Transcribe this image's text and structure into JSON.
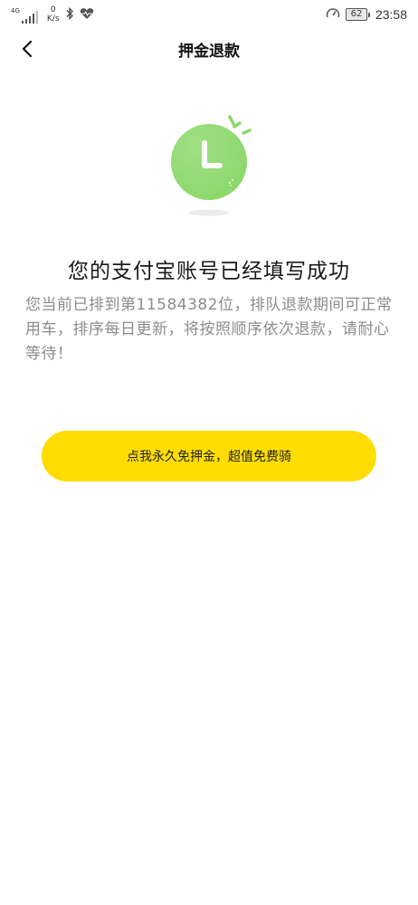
{
  "status_bar": {
    "network": "4G",
    "speed_value": "0",
    "speed_unit": "K/s",
    "battery": "62",
    "time": "23:58"
  },
  "nav": {
    "title": "押金退款"
  },
  "illustration": {
    "clock_letter": "L",
    "accent_color": "#8bd86a"
  },
  "main": {
    "headline": "您的支付宝账号已经填写成功",
    "description": "您当前已排到第11584382位，排队退款期间可正常用车，排序每日更新，将按照顺序依次退款，请耐心等待！"
  },
  "cta": {
    "label": "点我永久免押金，超值免费骑",
    "color": "#ffdd00"
  }
}
